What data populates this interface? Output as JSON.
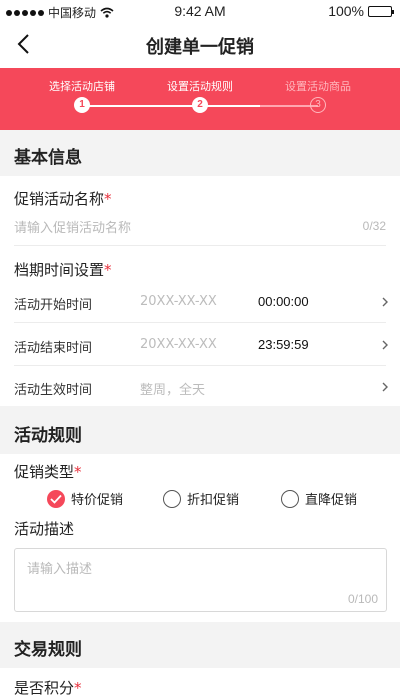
{
  "status_bar": {
    "carrier": "中国移动",
    "time": "9:42 AM",
    "battery": "100%"
  },
  "nav": {
    "title": "创建单一促销"
  },
  "stepper": {
    "steps": [
      {
        "label": "选择活动店铺",
        "number": "1"
      },
      {
        "label": "设置活动规则",
        "number": "2"
      },
      {
        "label": "设置活动商品",
        "number": "3"
      }
    ]
  },
  "basic_info": {
    "header": "基本信息",
    "name_field": {
      "label": "促销活动名称",
      "required": "*",
      "placeholder": "请输入促销活动名称",
      "counter": "0/32"
    },
    "schedule": {
      "label": "档期时间设置",
      "required": "*",
      "start": {
        "label": "活动开始时间",
        "date": "20XX-XX-XX",
        "time": "00:00:00"
      },
      "end": {
        "label": "活动结束时间",
        "date": "20XX-XX-XX",
        "time": "23:59:59"
      },
      "effective": {
        "label": "活动生效时间",
        "value": "整周，全天"
      }
    }
  },
  "activity_rules": {
    "header": "活动规则",
    "promo_type": {
      "label": "促销类型",
      "required": "*",
      "options": [
        "特价促销",
        "折扣促销",
        "直降促销"
      ],
      "selected": "特价促销"
    },
    "description": {
      "label": "活动描述",
      "placeholder": "请输入描述",
      "counter": "0/100"
    }
  },
  "trade_rules": {
    "header": "交易规则",
    "points": {
      "label": "是否积分",
      "required": "*"
    }
  },
  "colors": {
    "accent": "#f5485a",
    "required": "#e8303c"
  },
  "icons": {
    "back": "chevron-left-icon",
    "row_arrow": "chevron-right-icon",
    "radio_checked": "check-icon"
  }
}
